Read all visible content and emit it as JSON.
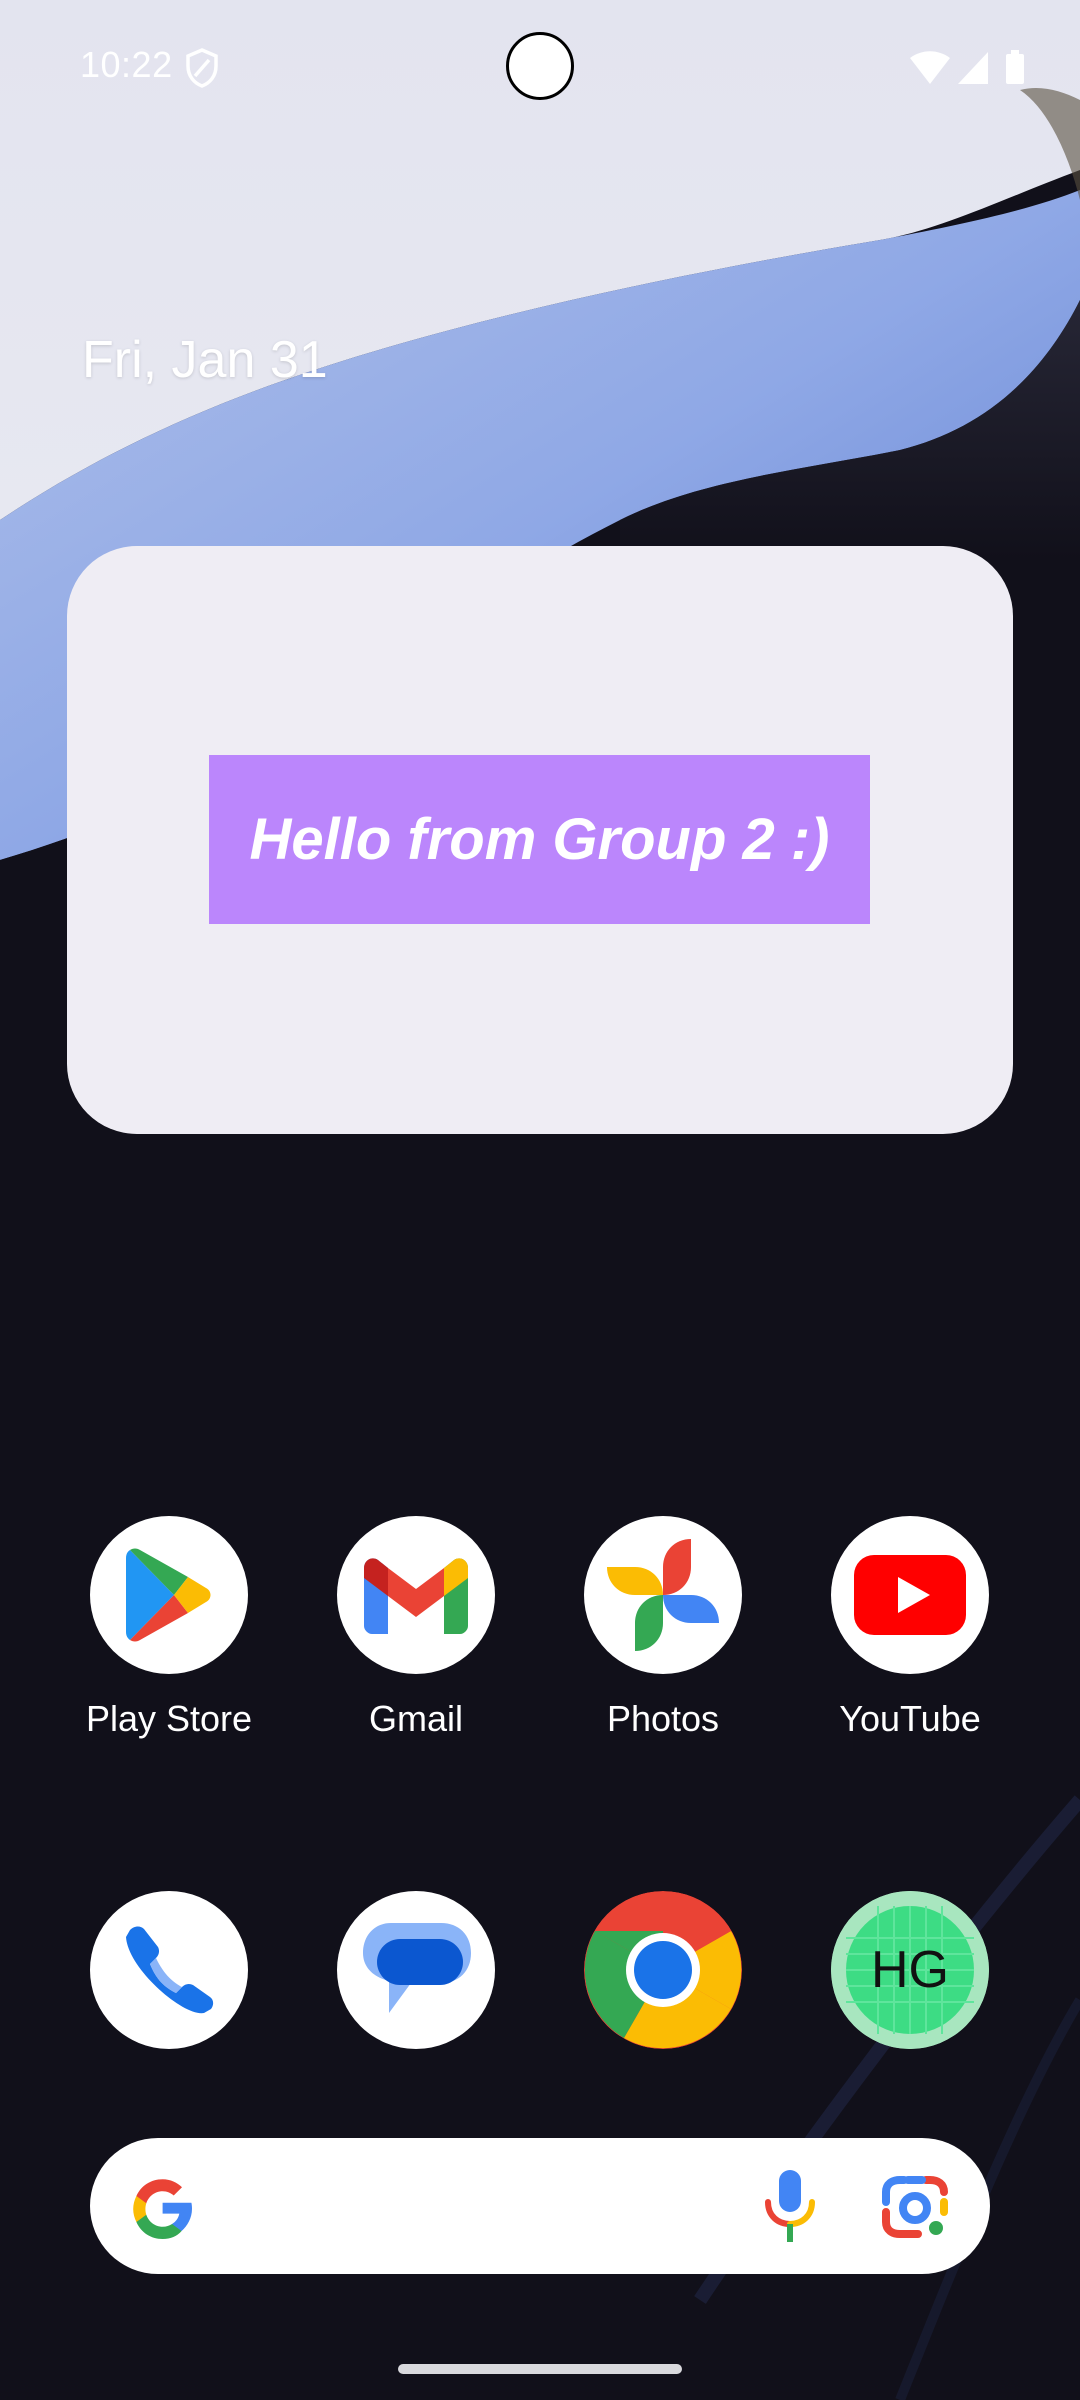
{
  "status_bar": {
    "time": "10:22",
    "shield_icon": "shield-icon",
    "wifi_icon": "wifi-icon",
    "signal_icon": "cell-signal-icon",
    "battery_icon": "battery-icon"
  },
  "home": {
    "date": "Fri, Jan 31"
  },
  "widget": {
    "text": "Hello from Group 2 :)",
    "banner_color": "#bb86fc",
    "background_color": "#efedf4"
  },
  "apps_row1": [
    {
      "label": "Play Store",
      "icon": "play-store-icon"
    },
    {
      "label": "Gmail",
      "icon": "gmail-icon"
    },
    {
      "label": "Photos",
      "icon": "photos-icon"
    },
    {
      "label": "YouTube",
      "icon": "youtube-icon"
    }
  ],
  "dock": [
    {
      "icon": "phone-icon"
    },
    {
      "icon": "messages-icon"
    },
    {
      "icon": "chrome-icon"
    },
    {
      "icon": "hg-app-icon",
      "text": "HG"
    }
  ],
  "search_bar": {
    "logo": "google-g-icon",
    "mic": "microphone-icon",
    "lens": "google-lens-icon"
  }
}
